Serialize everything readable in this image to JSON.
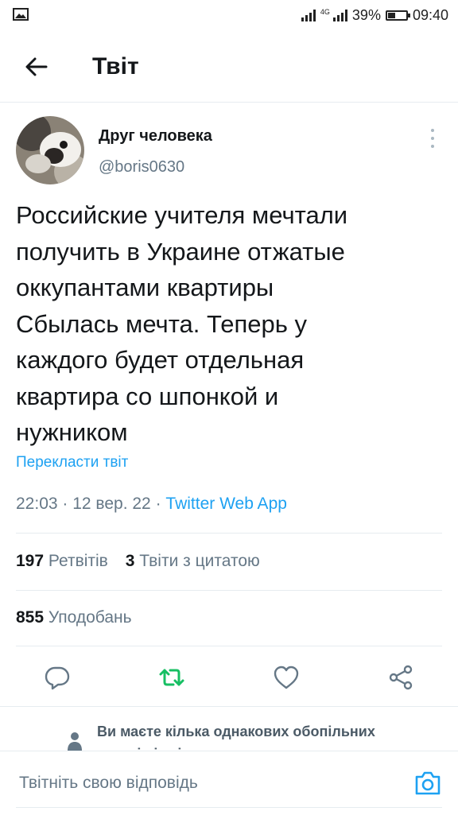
{
  "status_bar": {
    "network": "4G",
    "battery_percent": "39%",
    "battery_level": 0.39,
    "time": "09:40"
  },
  "header": {
    "title": "Твіт"
  },
  "tweet": {
    "author_name": "Друг человека",
    "author_handle": "@boris0630",
    "text_lines": [
      "Российские учителя мечтали",
      "получить в Украине отжатые",
      "оккупантами квартиры",
      "Сбылась мечта. Теперь у",
      "каждого будет отдельная",
      "квартира со шпонкой и",
      "нужником"
    ],
    "translate_label": "Перекласти твіт",
    "time": "22:03",
    "date": "12 вер. 22",
    "source": "Twitter Web App",
    "retweets_count": "197",
    "retweets_label": "Ретвітів",
    "quotes_count": "3",
    "quotes_label": "Твіти з цитатою",
    "likes_count": "855",
    "likes_label": "Уподобань"
  },
  "actions": {
    "reply_icon": "reply-icon",
    "retweet_icon": "retweet-icon",
    "like_icon": "heart-icon",
    "share_icon": "share-icon",
    "retweet_color": "#17bf63"
  },
  "notice": {
    "text": "Ви маєте кілька однакових обопільних читачів із цією людиною"
  },
  "reply_bar": {
    "placeholder": "Твітніть свою відповідь"
  },
  "colors": {
    "accent": "#1da1f2",
    "secondary_text": "#657786"
  }
}
